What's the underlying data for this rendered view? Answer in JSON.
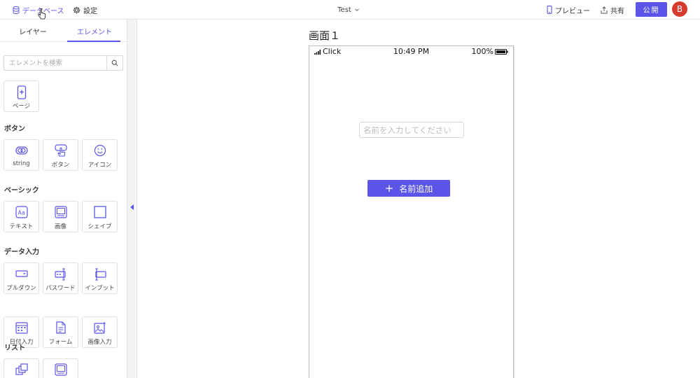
{
  "topbar": {
    "database_label": "データベース",
    "settings_label": "設定",
    "project_title": "Test",
    "preview_label": "プレビュー",
    "share_label": "共有",
    "publish_label": "公開",
    "avatar_initial": "B"
  },
  "panel": {
    "tabs": [
      {
        "label": "レイヤー",
        "active": false
      },
      {
        "label": "エレメント",
        "active": true
      }
    ],
    "search_placeholder": "エレメントを検索",
    "page_tile": {
      "label": "ページ",
      "icon": "page-add-icon"
    },
    "sections": [
      {
        "title": "ボタン",
        "items": [
          {
            "label": "string",
            "icon": "toggle-button-icon"
          },
          {
            "label": "ボタン",
            "icon": "tap-hand-icon"
          },
          {
            "label": "アイコン",
            "icon": "smiley-icon"
          }
        ]
      },
      {
        "title": "ベーシック",
        "items": [
          {
            "label": "テキスト",
            "icon": "text-aa-icon"
          },
          {
            "label": "画像",
            "icon": "image-frame-icon"
          },
          {
            "label": "シェイプ",
            "icon": "square-shape-icon"
          }
        ]
      },
      {
        "title": "データ入力",
        "items": [
          {
            "label": "プルダウン",
            "icon": "dropdown-icon"
          },
          {
            "label": "パスワード",
            "icon": "password-icon"
          },
          {
            "label": "インプット",
            "icon": "text-input-icon"
          },
          {
            "label": "日付入力",
            "icon": "calendar-icon"
          },
          {
            "label": "フォーム",
            "icon": "form-document-icon"
          },
          {
            "label": "画像入力",
            "icon": "image-upload-icon"
          }
        ]
      },
      {
        "title": "リスト",
        "items": [
          {
            "label": "",
            "icon": "stacked-list-icon"
          },
          {
            "label": "",
            "icon": "card-list-icon"
          }
        ]
      }
    ]
  },
  "canvas": {
    "screen_title": "画面１",
    "status_bar": {
      "carrier": "Click",
      "time": "10:49 PM",
      "battery": "100%"
    },
    "name_input_placeholder": "名前を入力してください",
    "add_button_label": "名前追加"
  },
  "colors": {
    "accent": "#5b54e8",
    "avatar": "#d73a2f"
  }
}
